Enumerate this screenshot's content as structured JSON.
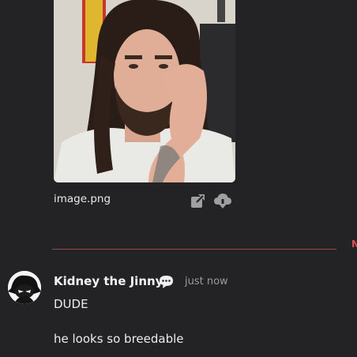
{
  "attachment": {
    "file_name": "image.png",
    "open_icon": "open-external-icon",
    "download_icon": "cloud-download-icon"
  },
  "divider": {
    "new_label": "N",
    "color": "#9b4a4a",
    "label_color": "#e0524f"
  },
  "message": {
    "author": "Kidney the Jinny",
    "badge_icon": "speech-bubble-icon",
    "timestamp": "just now",
    "lines": [
      "DUDE",
      "he looks so breedable"
    ]
  },
  "colors": {
    "background": "#232325",
    "text": "#ededee",
    "muted": "#9b9b9f"
  }
}
